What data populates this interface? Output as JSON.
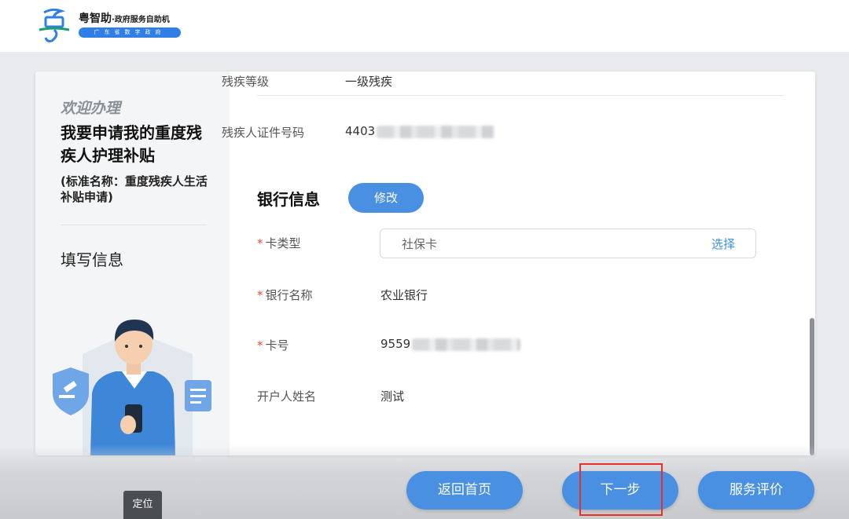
{
  "header": {
    "brand": "粤智助",
    "brand_sub": "·政府服务自助机",
    "badge": "广东省数字政府"
  },
  "left_panel": {
    "welcome": "欢迎办理",
    "service_title": "我要申请我的重度残疾人护理补贴",
    "standard_name": "(标准名称：重度残疾人生活补贴申请)",
    "current_step": "填写信息"
  },
  "form": {
    "rows_top": [
      {
        "label": "残疾等级",
        "value": "一级残疾"
      },
      {
        "label": "残疾人证件号码",
        "value": "4403"
      }
    ],
    "bank_section": {
      "title": "银行信息",
      "edit_label": "修改",
      "card_type": {
        "label": "卡类型",
        "value": "社保卡",
        "action": "选择"
      },
      "bank_name": {
        "label": "银行名称",
        "value": "农业银行"
      },
      "card_number": {
        "label": "卡号",
        "value": "9559"
      },
      "account_name": {
        "label": "开户人姓名",
        "value": "测试"
      }
    },
    "required_mark": "*"
  },
  "footer": {
    "locate": "定位",
    "home": "返回首页",
    "next": "下一步",
    "rate": "服务评价"
  },
  "colors": {
    "primary": "#4a90e2",
    "link": "#3a8ee6",
    "required": "#e8503a",
    "highlight": "#e8302a"
  }
}
